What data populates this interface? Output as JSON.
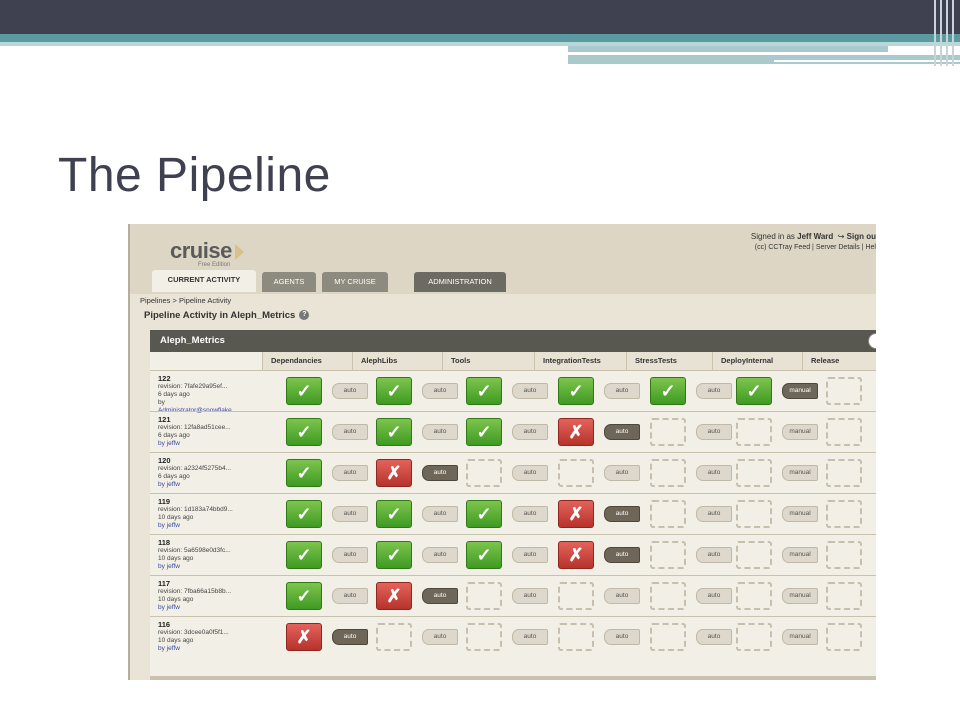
{
  "slide": {
    "title": "The Pipeline"
  },
  "header": {
    "logo": "cruise",
    "logo_sub": "Free Edition",
    "signed_in_prefix": "Signed in as",
    "signed_in_user": "Jeff Ward",
    "sign_out": "Sign ou",
    "links": "(cc) CCTray Feed  |  Server Details  |  Hel"
  },
  "tabs": [
    "CURRENT ACTIVITY",
    "AGENTS",
    "MY CRUISE",
    "ADMINISTRATION"
  ],
  "breadcrumb": "Pipelines > Pipeline Activity",
  "page_title": "Pipeline Activity in Aleph_Metrics",
  "pipeline": {
    "name": "Aleph_Metrics",
    "stages": [
      "Dependancies",
      "AlephLibs",
      "Tools",
      "IntegrationTests",
      "StressTests",
      "DeployInternal",
      "Release"
    ],
    "runs": [
      {
        "label": "122",
        "revision": "revision: 7fafe29a95ef...",
        "when": "6 days ago",
        "by": "by",
        "user": "Administrator@snowflake",
        "stages": [
          "pass",
          "pass",
          "pass",
          "pass",
          "pass",
          "pass",
          "pending"
        ],
        "triggers": [
          "auto",
          "auto",
          "auto",
          "auto",
          "auto",
          "manual"
        ],
        "dark": [
          5
        ]
      },
      {
        "label": "121",
        "revision": "revision: 12fa8ad51cee...",
        "when": "6 days ago",
        "by": "by jeffw",
        "user": "",
        "stages": [
          "pass",
          "pass",
          "pass",
          "fail",
          "pending",
          "pending",
          "pending"
        ],
        "triggers": [
          "auto",
          "auto",
          "auto",
          "auto",
          "auto",
          "manual"
        ],
        "dark": [
          3
        ]
      },
      {
        "label": "120",
        "revision": "revision: a2324f5275b4...",
        "when": "6 days ago",
        "by": "by jeffw",
        "user": "",
        "stages": [
          "pass",
          "fail",
          "pending",
          "pending",
          "pending",
          "pending",
          "pending"
        ],
        "triggers": [
          "auto",
          "auto",
          "auto",
          "auto",
          "auto",
          "manual"
        ],
        "dark": [
          1
        ]
      },
      {
        "label": "119",
        "revision": "revision: 1d183a74bbd9...",
        "when": "10 days ago",
        "by": "by jeffw",
        "user": "",
        "stages": [
          "pass",
          "pass",
          "pass",
          "fail",
          "pending",
          "pending",
          "pending"
        ],
        "triggers": [
          "auto",
          "auto",
          "auto",
          "auto",
          "auto",
          "manual"
        ],
        "dark": [
          3
        ]
      },
      {
        "label": "118",
        "revision": "revision: 5a6598e0d3fc...",
        "when": "10 days ago",
        "by": "by jeffw",
        "user": "",
        "stages": [
          "pass",
          "pass",
          "pass",
          "fail",
          "pending",
          "pending",
          "pending"
        ],
        "triggers": [
          "auto",
          "auto",
          "auto",
          "auto",
          "auto",
          "manual"
        ],
        "dark": [
          3
        ]
      },
      {
        "label": "117",
        "revision": "revision: 7fba66a15b8b...",
        "when": "10 days ago",
        "by": "by jeffw",
        "user": "",
        "stages": [
          "pass",
          "fail",
          "pending",
          "pending",
          "pending",
          "pending",
          "pending"
        ],
        "triggers": [
          "auto",
          "auto",
          "auto",
          "auto",
          "auto",
          "manual"
        ],
        "dark": [
          1
        ]
      },
      {
        "label": "116",
        "revision": "revision: 3dcee0a0f5f1...",
        "when": "10 days ago",
        "by": "by jeffw",
        "user": "",
        "stages": [
          "fail",
          "pending",
          "pending",
          "pending",
          "pending",
          "pending",
          "pending"
        ],
        "triggers": [
          "auto",
          "auto",
          "auto",
          "auto",
          "auto",
          "manual"
        ],
        "dark": [
          0
        ]
      }
    ]
  },
  "colors": {
    "pass": "#4ea82c",
    "fail": "#c9403a",
    "header": "#585850"
  }
}
